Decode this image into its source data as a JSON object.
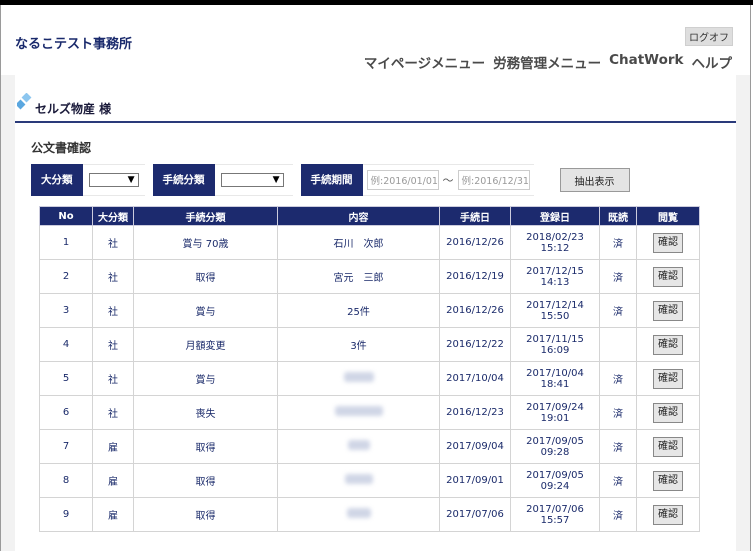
{
  "header": {
    "office_name": "なるこテスト事務所",
    "logoff_label": "ログオフ",
    "nav": [
      "マイページメニュー",
      "労務管理メニュー",
      "ChatWork",
      "ヘルプ"
    ]
  },
  "client": {
    "name": "セルズ物産 様"
  },
  "section_title": "公文書確認",
  "filters": {
    "major_label": "大分類",
    "procedure_label": "手続分類",
    "period_label": "手続期間",
    "date_from_placeholder": "例:2016/01/01",
    "tilde": "～",
    "date_to_placeholder": "例:2016/12/31",
    "extract_button": "抽出表示"
  },
  "table": {
    "headers": [
      "No",
      "大分類",
      "手続分類",
      "内容",
      "手続日",
      "登録日",
      "既読",
      "閲覧"
    ],
    "confirm_label": "確認",
    "rows": [
      {
        "no": "1",
        "major": "社",
        "procedure": "賞与 70歳",
        "content": "石川　次郎",
        "blurred": false,
        "proc_date": "2016/12/26",
        "reg_date": "2018/02/23 15:12",
        "read": "済"
      },
      {
        "no": "2",
        "major": "社",
        "procedure": "取得",
        "content": "宮元　三郎",
        "blurred": false,
        "proc_date": "2016/12/19",
        "reg_date": "2017/12/15 14:13",
        "read": "済"
      },
      {
        "no": "3",
        "major": "社",
        "procedure": "賞与",
        "content": "25件",
        "blurred": false,
        "proc_date": "2016/12/26",
        "reg_date": "2017/12/14 15:50",
        "read": "済"
      },
      {
        "no": "4",
        "major": "社",
        "procedure": "月額変更",
        "content": "3件",
        "blurred": false,
        "proc_date": "2016/12/22",
        "reg_date": "2017/11/15 16:09",
        "read": ""
      },
      {
        "no": "5",
        "major": "社",
        "procedure": "賞与",
        "content": "",
        "blurred": true,
        "proc_date": "2017/10/04",
        "reg_date": "2017/10/04 18:41",
        "read": "済"
      },
      {
        "no": "6",
        "major": "社",
        "procedure": "喪失",
        "content": "",
        "blurred": true,
        "proc_date": "2016/12/23",
        "reg_date": "2017/09/24 19:01",
        "read": "済"
      },
      {
        "no": "7",
        "major": "雇",
        "procedure": "取得",
        "content": "",
        "blurred": true,
        "proc_date": "2017/09/04",
        "reg_date": "2017/09/05 09:28",
        "read": "済"
      },
      {
        "no": "8",
        "major": "雇",
        "procedure": "取得",
        "content": "",
        "blurred": true,
        "proc_date": "2017/09/01",
        "reg_date": "2017/09/05 09:24",
        "read": "済"
      },
      {
        "no": "9",
        "major": "雇",
        "procedure": "取得",
        "content": "",
        "blurred": true,
        "proc_date": "2017/07/06",
        "reg_date": "2017/07/06 15:57",
        "read": "済"
      }
    ]
  },
  "colors": {
    "navy": "#1c2a6e",
    "accent_line": "#2a3a7a",
    "diamond": "#6fb3e6",
    "page_bg": "#f2f2f2"
  }
}
